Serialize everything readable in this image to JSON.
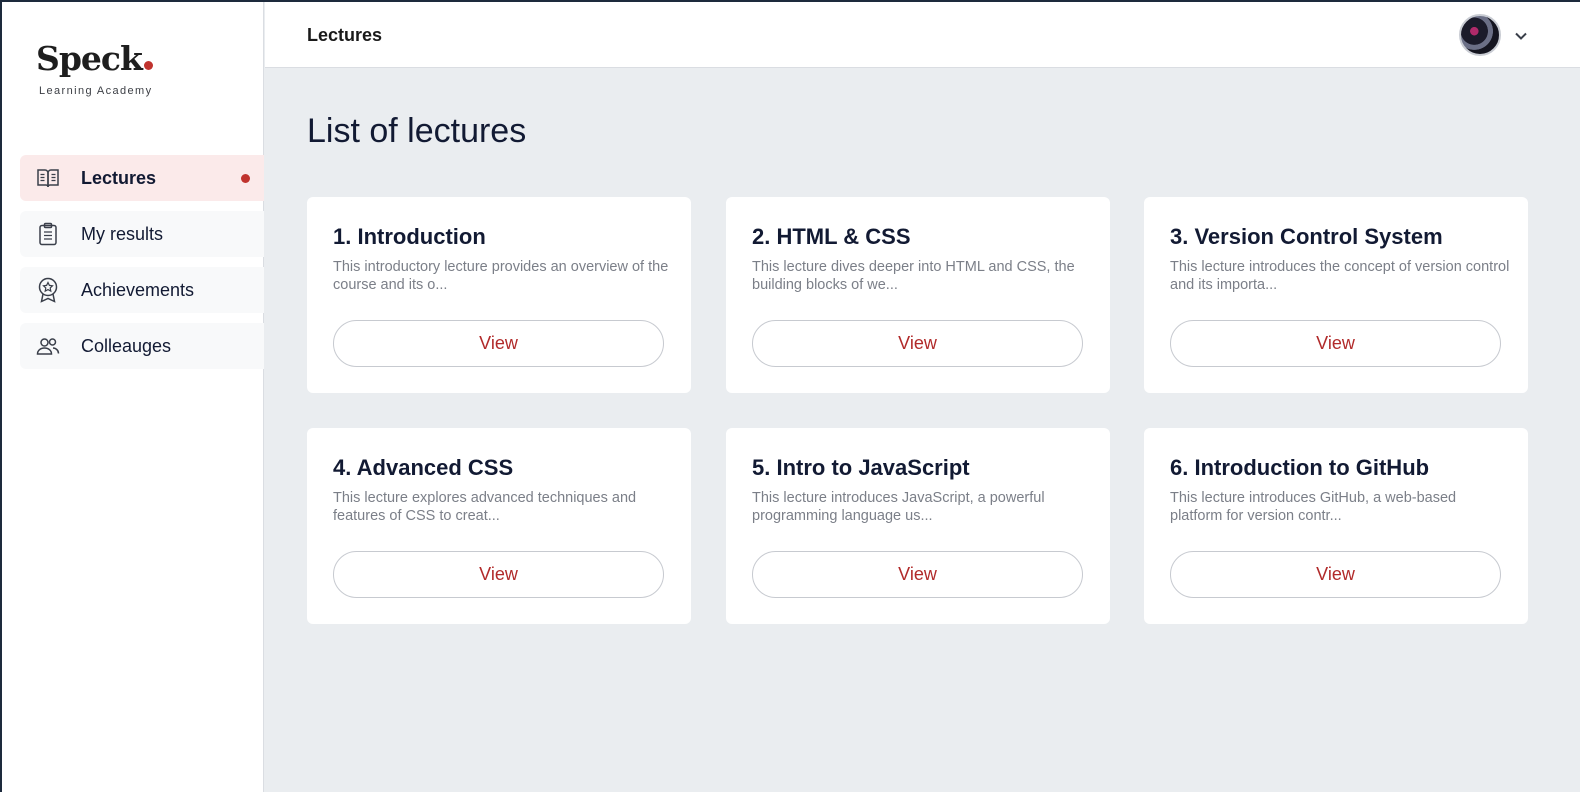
{
  "brand": {
    "name": "Speck",
    "tagline": "Learning Academy",
    "accent": "#c0332e"
  },
  "sidebar": {
    "items": [
      {
        "label": "Lectures",
        "icon": "book-icon",
        "active": true
      },
      {
        "label": "My results",
        "icon": "clipboard-icon",
        "active": false
      },
      {
        "label": "Achievements",
        "icon": "award-icon",
        "active": false
      },
      {
        "label": "Colleauges",
        "icon": "users-icon",
        "active": false
      }
    ]
  },
  "header": {
    "title": "Lectures",
    "user_menu_icon": "chevron-down-icon"
  },
  "main": {
    "title": "List of lectures",
    "lectures": [
      {
        "title": "1. Introduction",
        "description": "This introductory lecture provides an overview of the course and its o...",
        "button": "View"
      },
      {
        "title": "2. HTML & CSS",
        "description": "This lecture dives deeper into HTML and CSS, the building blocks of we...",
        "button": "View"
      },
      {
        "title": "3. Version Control System",
        "description": "This lecture introduces the concept of version control and its importa...",
        "button": "View"
      },
      {
        "title": "4. Advanced CSS",
        "description": "This lecture explores advanced techniques and features of CSS to creat...",
        "button": "View"
      },
      {
        "title": "5. Intro to JavaScript",
        "description": "This lecture introduces JavaScript, a powerful programming language us...",
        "button": "View"
      },
      {
        "title": "6. Introduction to GitHub",
        "description": "This lecture introduces GitHub, a web-based platform for version contr...",
        "button": "View"
      }
    ]
  }
}
